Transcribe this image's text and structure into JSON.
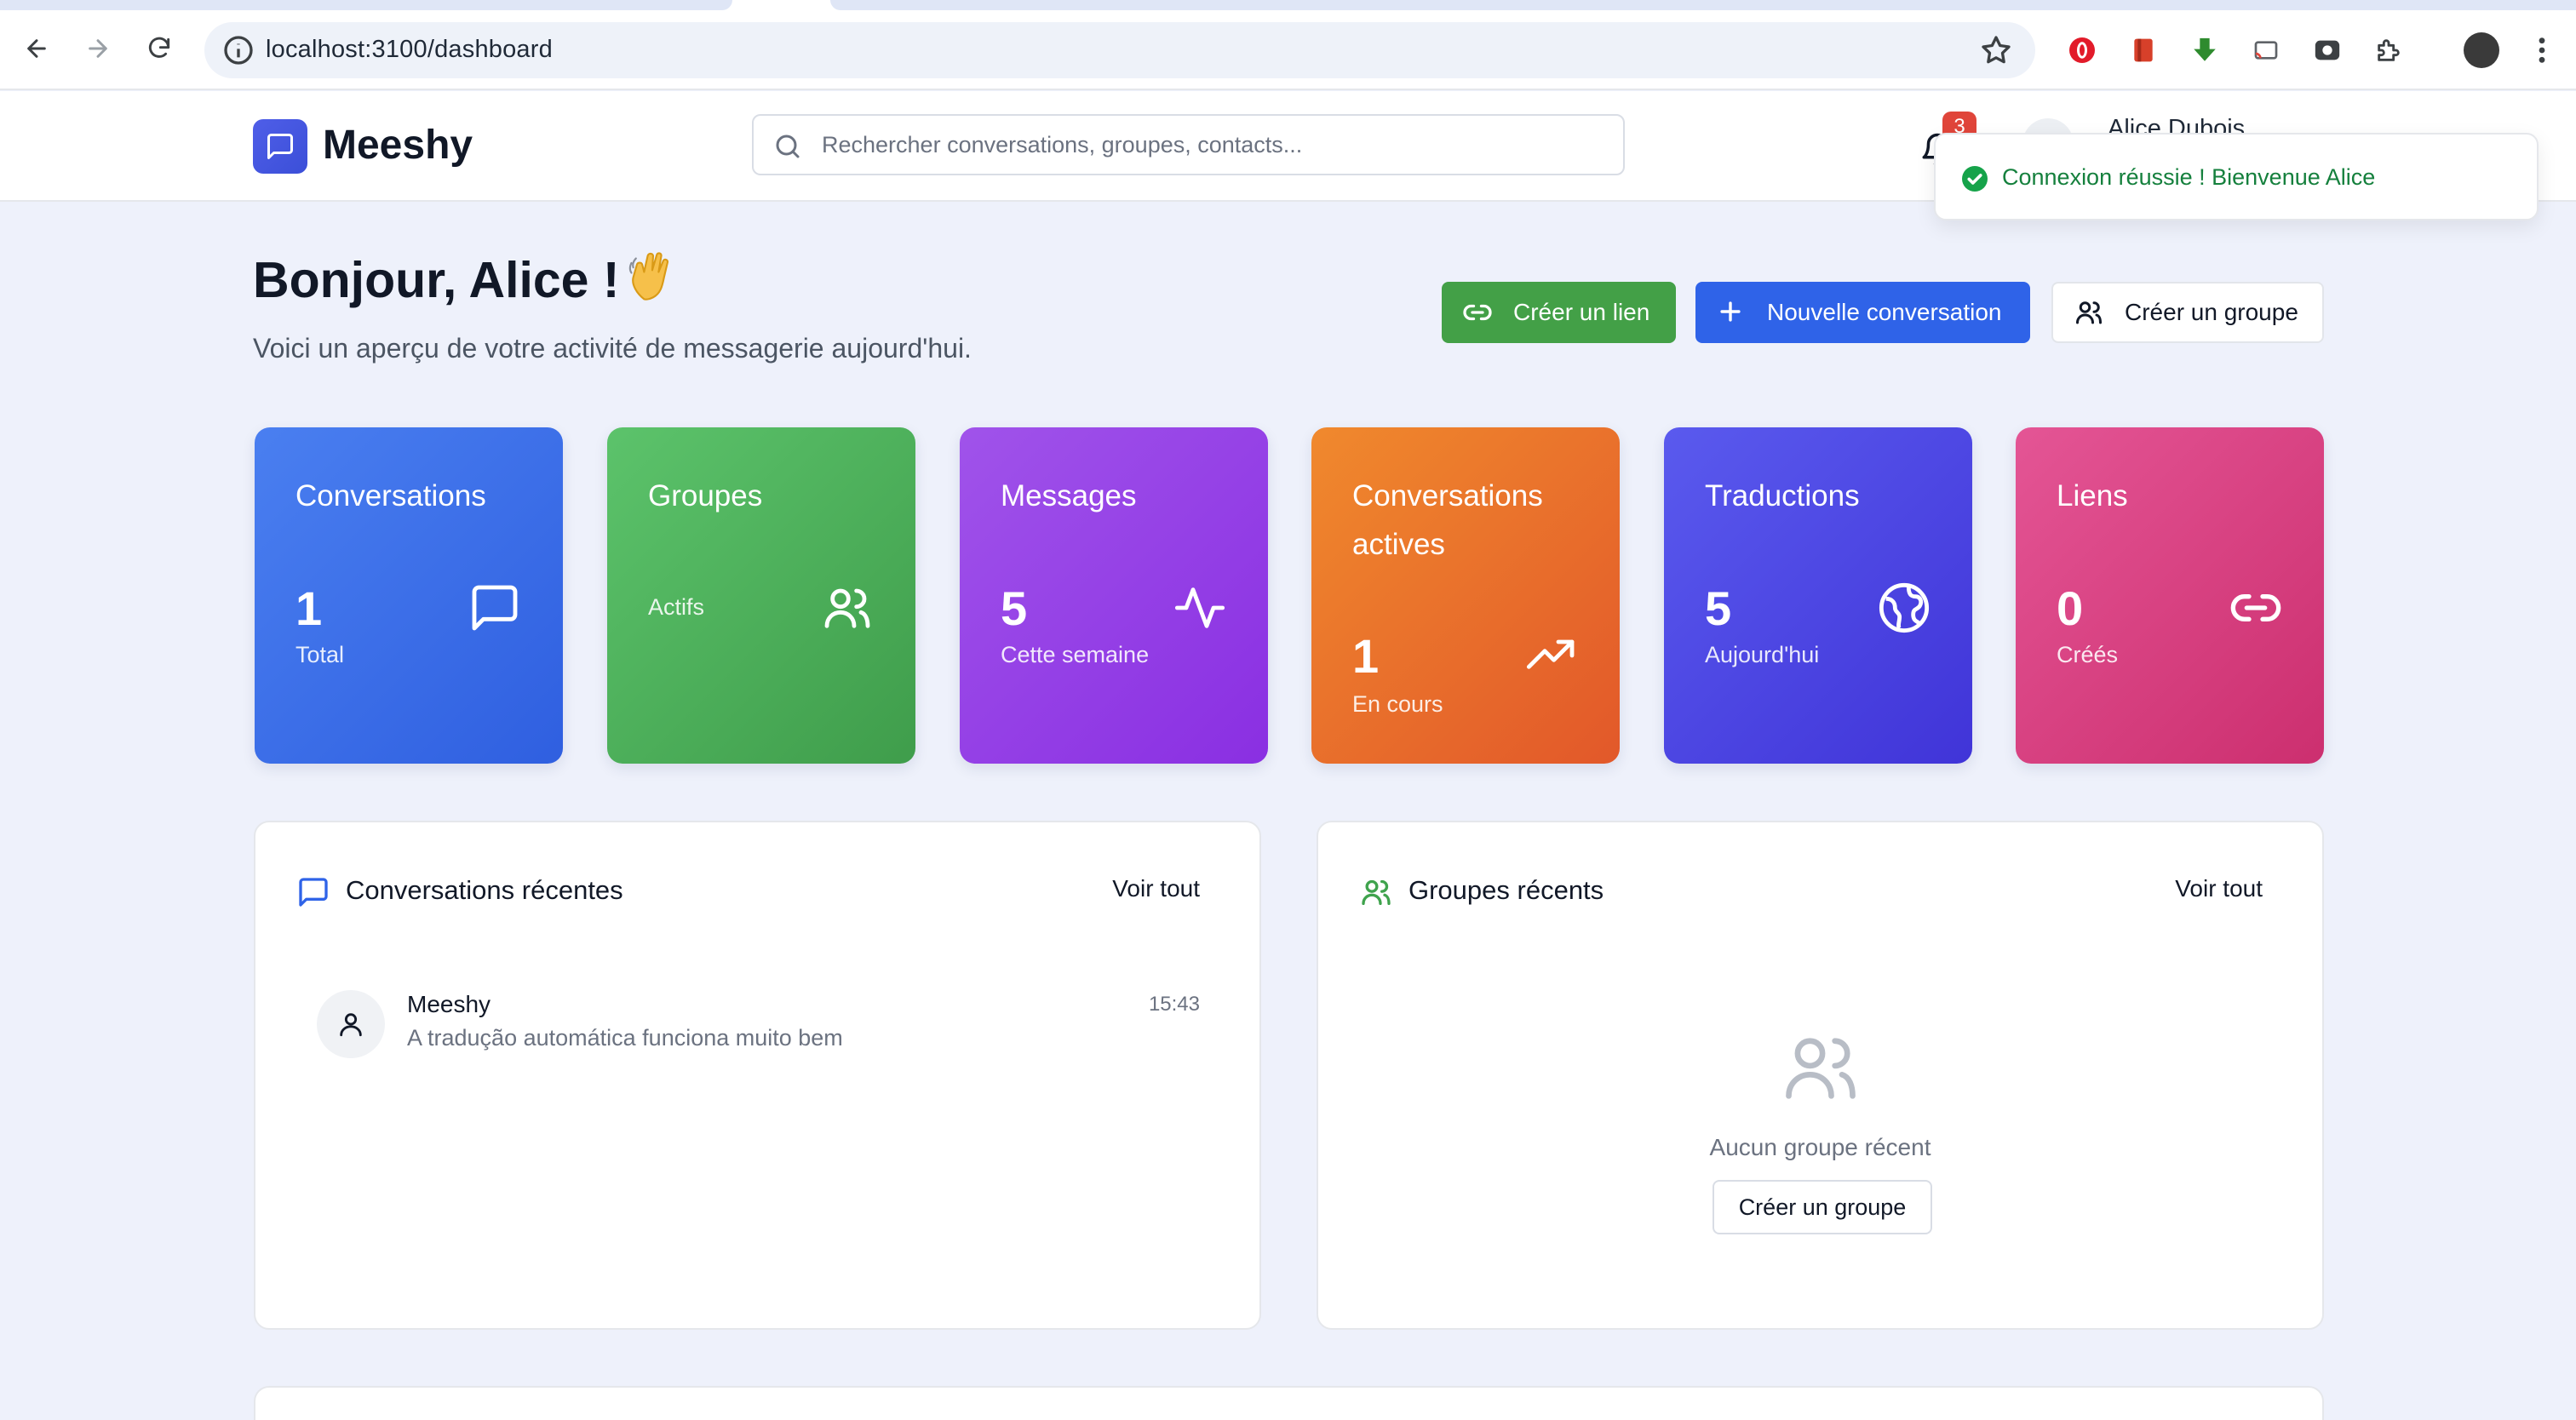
{
  "browser": {
    "url": "localhost:3100/dashboard"
  },
  "header": {
    "brand": "Meeshy",
    "search_placeholder": "Rechercher conversations, groupes, contacts...",
    "notification_count": "3",
    "user_name": "Alice Dubois"
  },
  "toast": {
    "message": "Connexion réussie ! Bienvenue Alice",
    "color": "#15803d"
  },
  "greeting": {
    "title": "Bonjour, Alice !",
    "emoji": "waving-hand-icon",
    "subtitle": "Voici un aperçu de votre activité de messagerie aujourd'hui."
  },
  "actions": {
    "create_link": "Créer un lien",
    "new_conversation": "Nouvelle conversation",
    "create_group": "Créer un groupe"
  },
  "stats": [
    {
      "title": "Conversations",
      "value": "1",
      "label": "Total",
      "icon": "message-square-icon",
      "color": "#3b6ff0"
    },
    {
      "title": "Groupes",
      "value": "",
      "label": "Actifs",
      "icon": "users-icon",
      "color": "#4caf50"
    },
    {
      "title": "Messages",
      "value": "5",
      "label": "Cette semaine",
      "icon": "activity-icon",
      "color": "#9a44e8"
    },
    {
      "title": "Conversations actives",
      "value": "1",
      "label": "En cours",
      "icon": "trending-up-icon",
      "color": "#ea6f2a"
    },
    {
      "title": "Traductions",
      "value": "5",
      "label": "Aujourd'hui",
      "icon": "globe-icon",
      "color": "#4f46e5"
    },
    {
      "title": "Liens",
      "value": "0",
      "label": "Créés",
      "icon": "link-icon",
      "color": "#db4282"
    }
  ],
  "recent_conversations": {
    "title": "Conversations récentes",
    "see_all": "Voir tout",
    "items": [
      {
        "name": "Meeshy",
        "last_message": "A tradução automática funciona muito bem",
        "time": "15:43"
      }
    ]
  },
  "recent_groups": {
    "title": "Groupes récents",
    "see_all": "Voir tout",
    "empty_text": "Aucun groupe récent",
    "empty_button": "Créer un groupe"
  }
}
